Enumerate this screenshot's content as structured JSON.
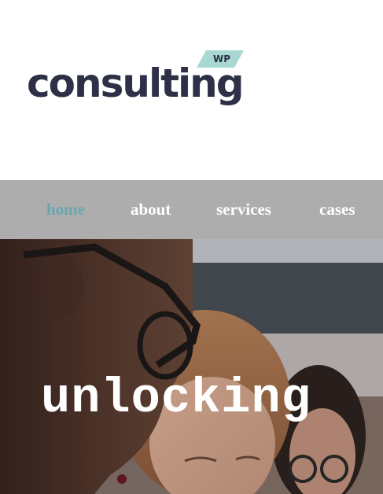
{
  "brand": {
    "wordmark": "consulting",
    "tag": "WP",
    "colors": {
      "wordmark": "#2d3047",
      "tag_background": "#a8d8d2"
    }
  },
  "nav": {
    "background": "#adadad",
    "active_color": "#6ba6ae",
    "items": [
      {
        "label": "home",
        "active": true
      },
      {
        "label": "about",
        "active": false
      },
      {
        "label": "services",
        "active": false
      },
      {
        "label": "cases",
        "active": false
      }
    ]
  },
  "hero": {
    "headline": "unlocking",
    "image": "team-meeting-photo"
  }
}
